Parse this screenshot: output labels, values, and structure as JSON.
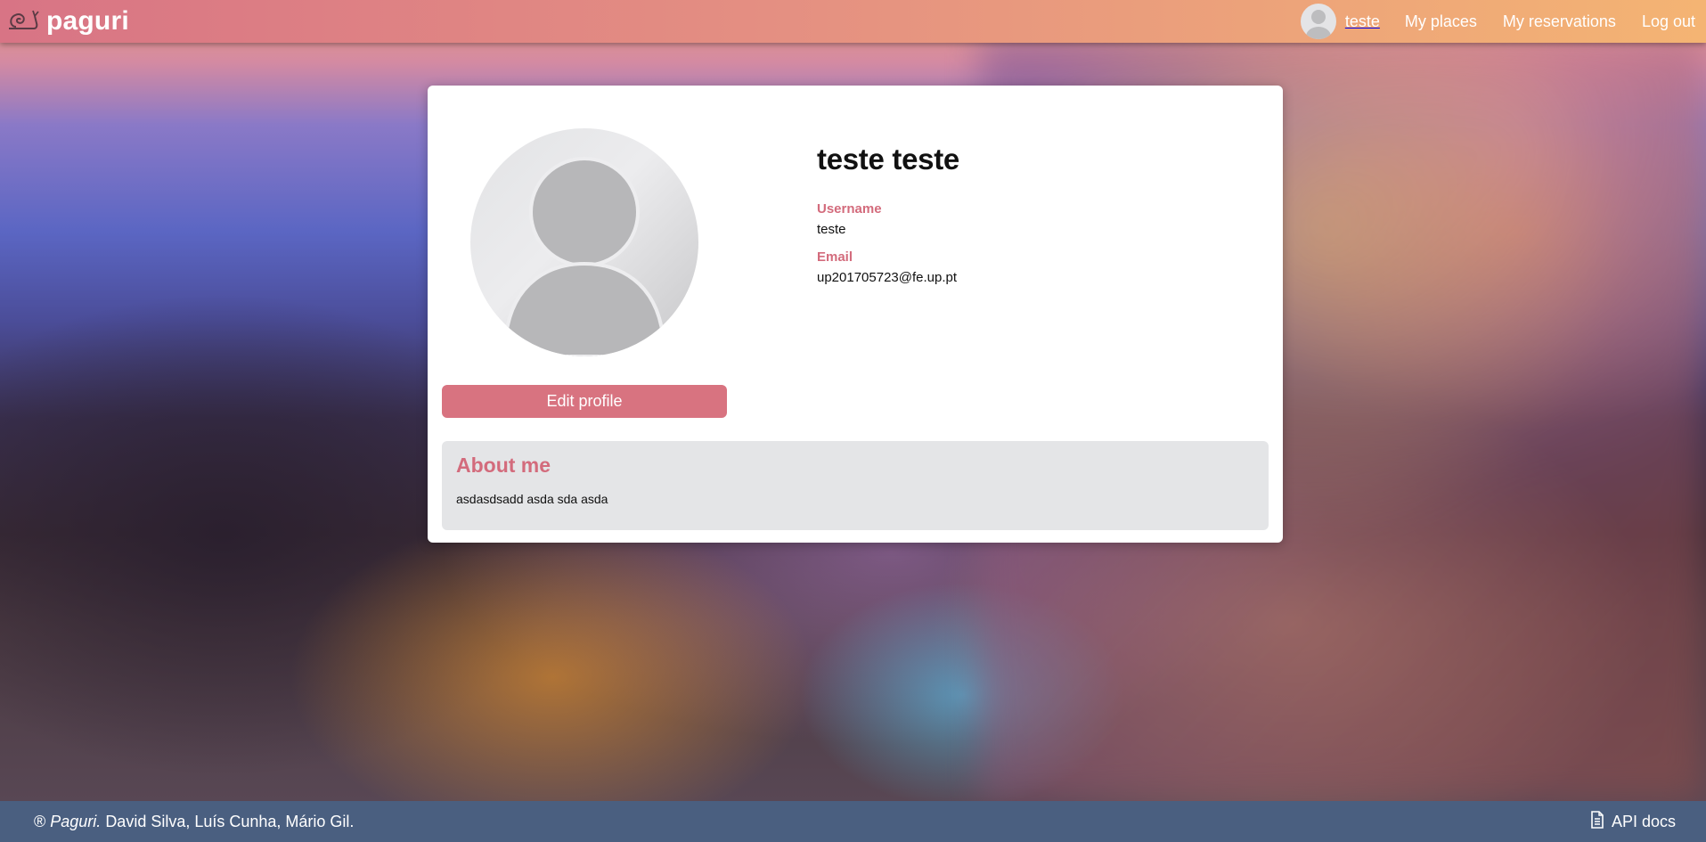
{
  "header": {
    "brand": "paguri",
    "logo_icon": "snail-icon",
    "user_name": "teste",
    "nav": [
      {
        "label": "My places"
      },
      {
        "label": "My reservations"
      },
      {
        "label": "Log out"
      }
    ]
  },
  "profile": {
    "full_name": "teste teste",
    "username_label": "Username",
    "username": "teste",
    "email_label": "Email",
    "email": "up201705723@fe.up.pt",
    "edit_label": "Edit profile",
    "about_title": "About me",
    "about_text": "asdasdsadd asda sda asda"
  },
  "footer": {
    "symbol": "®",
    "brand": "Paguri.",
    "authors": "David Silva, Luís Cunha, Mário Gil.",
    "api_label": "API docs",
    "api_icon": "document-icon"
  },
  "colors": {
    "accent": "#d87380",
    "footer": "#4a5f80"
  }
}
